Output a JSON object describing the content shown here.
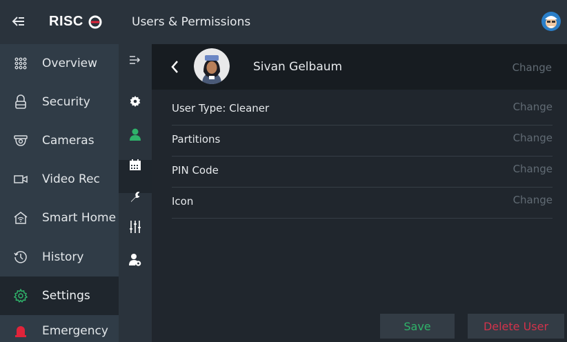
{
  "app": {
    "logo_text": "RISC",
    "header_title": "Users & Permissions"
  },
  "sidebar": {
    "items": [
      {
        "label": "Overview",
        "icon": "grid-icon"
      },
      {
        "label": "Security",
        "icon": "lock-icon"
      },
      {
        "label": "Cameras",
        "icon": "camera-icon"
      },
      {
        "label": "Video Rec",
        "icon": "video-camera-icon"
      },
      {
        "label": "Smart Home",
        "icon": "smart-home-icon"
      },
      {
        "label": "History",
        "icon": "history-icon"
      },
      {
        "label": "Settings",
        "icon": "gear-icon",
        "active": true
      },
      {
        "label": "Emergency",
        "icon": "alarm-icon"
      }
    ]
  },
  "subnav": {
    "icons": [
      "collapse-arrow-icon",
      "settings-gear-icon",
      "user-icon",
      "calendar-icon",
      "wrench-icon",
      "sliders-icon",
      "user-settings-icon"
    ]
  },
  "user": {
    "name": "Sivan Gelbaum",
    "change_label": "Change"
  },
  "rows": [
    {
      "label": "User Type: Cleaner",
      "action": "Change"
    },
    {
      "label": "Partitions",
      "action": "Change"
    },
    {
      "label": "PIN Code",
      "action": "Change"
    },
    {
      "label": "Icon",
      "action": "Change"
    }
  ],
  "buttons": {
    "save": "Save",
    "delete": "Delete User"
  },
  "colors": {
    "accent_green": "#2fb36a",
    "danger_red": "#d2334b",
    "muted_text": "#616b74"
  }
}
